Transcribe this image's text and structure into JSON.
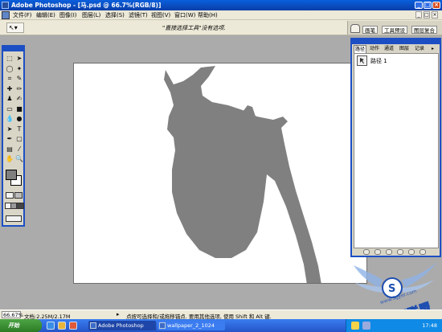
{
  "window": {
    "title": "Adobe Photoshop - [马.psd @ 66.7%(RGB/8)]",
    "controls": {
      "minimize": "_",
      "maximize": "□",
      "close": "×"
    }
  },
  "menubar": {
    "items": [
      "文件(F)",
      "编辑(E)",
      "图像(I)",
      "图层(L)",
      "选择(S)",
      "滤镜(T)",
      "视图(V)",
      "窗口(W)",
      "帮助(H)"
    ],
    "doc_controls": {
      "minimize": "_",
      "restore": "□",
      "close": "×"
    }
  },
  "options": {
    "tool_icon": "arrow-pointer-icon",
    "tool_glyph": "↖▾",
    "hint": "\"直接选择工具\"没有选项.",
    "well_tabs": [
      "画笔",
      "工具预设",
      "图层复合"
    ]
  },
  "toolbox": {
    "tools": [
      {
        "icon": "marquee-icon",
        "glyph": "⬚"
      },
      {
        "icon": "move-icon",
        "glyph": "➤"
      },
      {
        "icon": "lasso-icon",
        "glyph": "◯"
      },
      {
        "icon": "magic-wand-icon",
        "glyph": "✦"
      },
      {
        "icon": "crop-icon",
        "glyph": "⌗"
      },
      {
        "icon": "slice-icon",
        "glyph": "✎"
      },
      {
        "icon": "healing-icon",
        "glyph": "✚"
      },
      {
        "icon": "brush-icon",
        "glyph": "✏"
      },
      {
        "icon": "stamp-icon",
        "glyph": "♟"
      },
      {
        "icon": "history-brush-icon",
        "glyph": "✍"
      },
      {
        "icon": "eraser-icon",
        "glyph": "▭"
      },
      {
        "icon": "gradient-icon",
        "glyph": "■"
      },
      {
        "icon": "blur-icon",
        "glyph": "💧"
      },
      {
        "icon": "dodge-icon",
        "glyph": "●"
      },
      {
        "icon": "path-select-icon",
        "glyph": "➤"
      },
      {
        "icon": "type-icon",
        "glyph": "T"
      },
      {
        "icon": "pen-icon",
        "glyph": "✒"
      },
      {
        "icon": "shape-icon",
        "glyph": "▢"
      },
      {
        "icon": "notes-icon",
        "glyph": "▤"
      },
      {
        "icon": "eyedropper-icon",
        "glyph": "⁄"
      },
      {
        "icon": "hand-icon",
        "glyph": "✋"
      },
      {
        "icon": "zoom-icon",
        "glyph": "🔍"
      }
    ],
    "foreground_color": "#7f7f7f",
    "background_color": "#ffffff"
  },
  "canvas": {
    "background": "#ffffff",
    "shape_color": "#808080"
  },
  "paths_panel": {
    "tabs": [
      "路径",
      "动作",
      "通道",
      "图层",
      "记录"
    ],
    "active_tab": "路径",
    "rows": [
      {
        "label": "路径 1",
        "icon": "path-thumbnail-icon"
      }
    ]
  },
  "statusbar": {
    "zoom": "66.67%",
    "doc_info": "文档:2.25M/2.17M",
    "message": "点按可选择和/或拖移锚点. 要用其他选项, 使用 Shift 和 Alt 键."
  },
  "taskbar": {
    "start_label": "开始",
    "tasks": [
      "Adobe Photoshop",
      "wallpaper_2_1024"
    ],
    "clock": "17:48"
  },
  "watermark": {
    "text": "岩石联盟",
    "url": "www.Sgyer.com"
  },
  "colors": {
    "title_bar": "#0a4ac0",
    "panel_border": "#1d4fc4",
    "workspace": "#ababab",
    "chrome": "#ece9d8"
  }
}
